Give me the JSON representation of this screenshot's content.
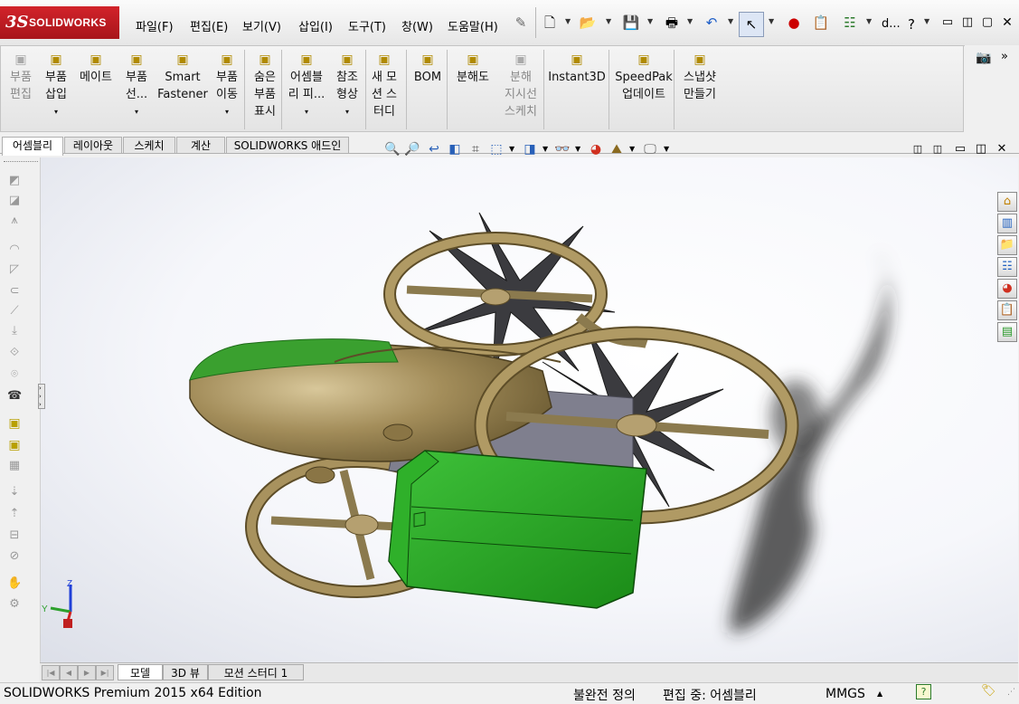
{
  "app": {
    "logo_ds": "3S",
    "logo_text": "SOLIDWORKS"
  },
  "menu": [
    "파일(F)",
    "편집(E)",
    "보기(V)",
    "삽입(I)",
    "도구(T)",
    "창(W)",
    "도움말(H)"
  ],
  "title_right": {
    "user": "d...",
    "help": "?"
  },
  "commands": [
    {
      "label": "부품\n편집",
      "icon": "edit-component-icon",
      "dim": true
    },
    {
      "label": "부품\n삽입",
      "icon": "insert-components-icon",
      "dim": false,
      "arrow": true
    },
    {
      "label": "메이트",
      "icon": "mate-icon",
      "dim": false
    },
    {
      "label": "부품\n선...",
      "icon": "linear-pattern-icon",
      "dim": false,
      "arrow": true
    },
    {
      "label": "Smart\nFastener",
      "icon": "smart-fastener-icon",
      "dim": false
    },
    {
      "label": "부품\n이동",
      "icon": "move-component-icon",
      "dim": false,
      "arrow": true
    },
    {
      "label": "숨은\n부품\n표시",
      "icon": "show-hidden-icon",
      "dim": false
    },
    {
      "label": "어셈블\n리 피...",
      "icon": "assembly-feature-icon",
      "dim": false,
      "arrow": true
    },
    {
      "label": "참조\n형상",
      "icon": "reference-geometry-icon",
      "dim": false,
      "arrow": true
    },
    {
      "label": "새 모\n션 스\n터디",
      "icon": "motion-study-icon",
      "dim": false
    },
    {
      "label": "BOM",
      "icon": "bom-icon",
      "dim": false
    },
    {
      "label": "분해도",
      "icon": "exploded-view-icon",
      "dim": false
    },
    {
      "label": "분해\n지시선\n스케치",
      "icon": "explode-line-sketch-icon",
      "dim": true
    },
    {
      "label": "Instant3D",
      "icon": "instant3d-icon",
      "dim": false
    },
    {
      "label": "SpeedPak\n업데이트",
      "icon": "speedpak-icon",
      "dim": false
    },
    {
      "label": "스냅샷\n만들기",
      "icon": "snapshot-icon",
      "dim": false
    }
  ],
  "tabs": [
    "어셈블리",
    "레이아웃",
    "스케치",
    "계산",
    "SOLIDWORKS 애드인"
  ],
  "bottom_tabs": [
    "모델",
    "3D 뷰",
    "모션 스터디 1"
  ],
  "triad": {
    "z": "Z",
    "y": "Y"
  },
  "status": {
    "product": "SOLIDWORKS Premium 2015 x64 Edition",
    "definition": "불완전 정의",
    "editing": "편집 중: 어셈블리",
    "units": "MMGS"
  },
  "colors": {
    "logo_red": "#c41e26",
    "body_brown": "#8b7a4e",
    "canopy_green": "#2fa52a"
  }
}
